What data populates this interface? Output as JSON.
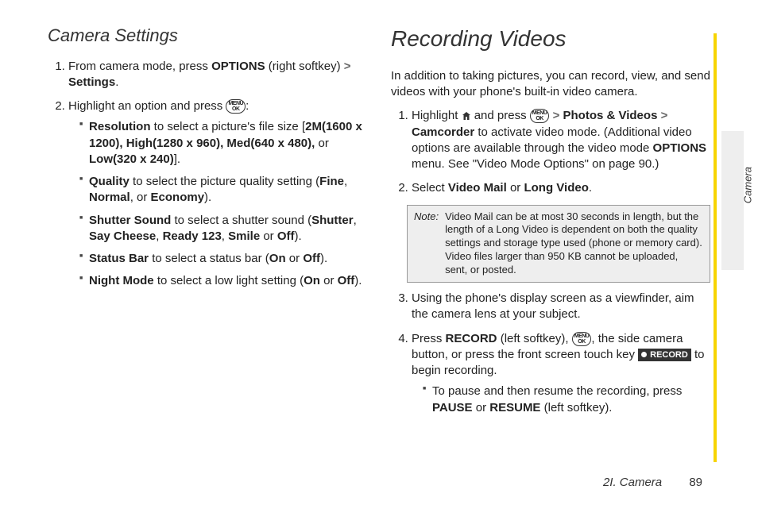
{
  "left": {
    "heading": "Camera Settings",
    "step1_a": "From camera mode, press ",
    "step1_b": "OPTIONS",
    "step1_c": " (right softkey) ",
    "step1_d": "Settings",
    "step1_e": ".",
    "step2_a": "Highlight an option and press ",
    "step2_b": ":",
    "b1_a": "Resolution",
    "b1_b": " to select a picture's file size [",
    "b1_c": "2M(1600 x 1200), High(1280 x 960), Med(640 x 480),",
    "b1_d": " or ",
    "b1_e": "Low(320 x 240)",
    "b1_f": "].",
    "b2_a": "Quality",
    "b2_b": " to select the picture quality setting (",
    "b2_c": "Fine",
    "b2_d": ", ",
    "b2_e": "Normal",
    "b2_f": ", or ",
    "b2_g": "Economy",
    "b2_h": ").",
    "b3_a": "Shutter Sound",
    "b3_b": " to select a shutter sound (",
    "b3_c": "Shutter",
    "b3_d": ", ",
    "b3_e": "Say Cheese",
    "b3_f": ", ",
    "b3_g": "Ready 123",
    "b3_h": ", ",
    "b3_i": "Smile",
    "b3_j": " or ",
    "b3_k": "Off",
    "b3_l": ").",
    "b4_a": "Status Bar",
    "b4_b": " to select a status bar (",
    "b4_c": "On",
    "b4_d": " or ",
    "b4_e": "Off",
    "b4_f": ").",
    "b5_a": "Night Mode",
    "b5_b": " to select a low light setting (",
    "b5_c": "On",
    "b5_d": " or ",
    "b5_e": "Off",
    "b5_f": ")."
  },
  "right": {
    "heading": "Recording Videos",
    "intro": "In addition to taking pictures, you can record, view, and send videos with your phone's built-in video camera.",
    "s1_a": "Highlight ",
    "s1_b": " and press ",
    "s1_c": "Photos & Videos",
    "s1_d": "Camcorder",
    "s1_e": " to activate video mode. (Additional video options are available through the video mode ",
    "s1_f": "OPTIONS",
    "s1_g": " menu. See \"Video Mode Options\" on page 90.)",
    "s2_a": "Select ",
    "s2_b": "Video Mail",
    "s2_c": " or ",
    "s2_d": "Long Video",
    "s2_e": ".",
    "note_label": "Note:",
    "note_body": "Video Mail can be at most 30 seconds in length, but the length of a Long Video is dependent on both the quality settings and storage type used (phone or memory card). Video files larger than 950 KB cannot be uploaded, sent, or posted.",
    "s3": "Using the phone's display screen as a viewfinder, aim the camera lens at your subject.",
    "s4_a": "Press ",
    "s4_b": "RECORD",
    "s4_c": " (left softkey), ",
    "s4_d": ", the side camera button, or press the front screen touch key ",
    "s4_e": " to begin recording.",
    "s4_btn": "RECORD",
    "sub_a": "To pause and then resume the recording, press ",
    "sub_b": "PAUSE",
    "sub_c": " or ",
    "sub_d": "RESUME",
    "sub_e": " (left softkey)."
  },
  "side_label": "Camera",
  "footer_section": "2I. Camera",
  "footer_page": "89",
  "icon_menu": "MENU",
  "icon_ok": "OK",
  "gt": ">"
}
